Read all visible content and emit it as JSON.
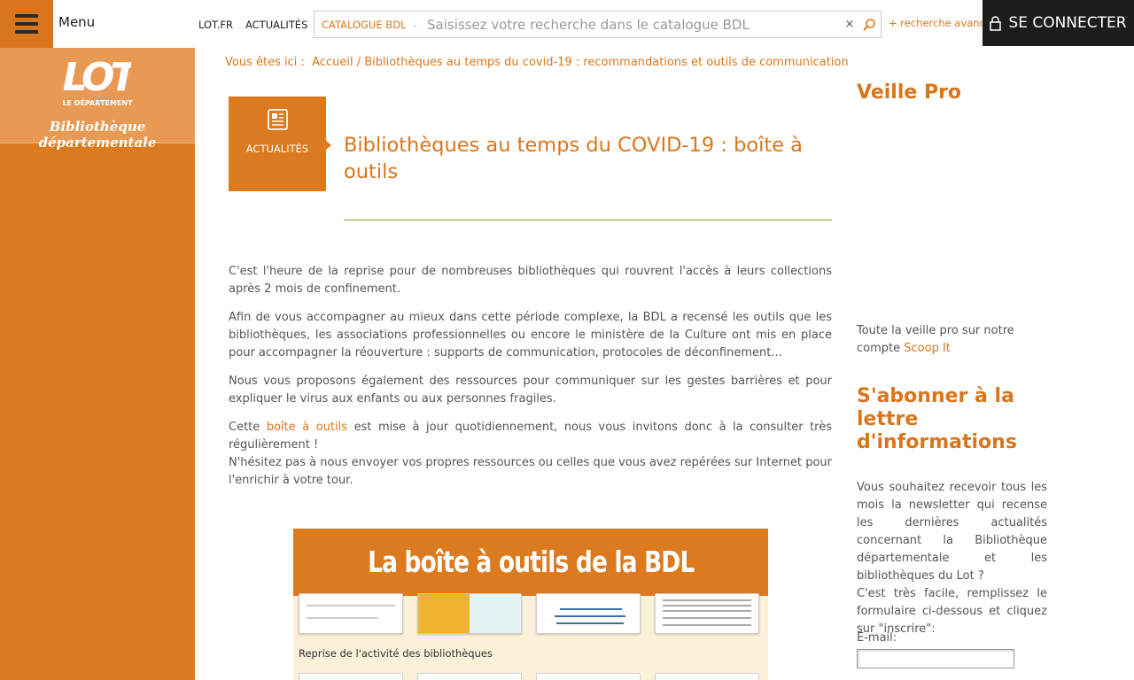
{
  "header": {
    "menu_label": "Menu",
    "links": [
      "LOT.FR",
      "ACTUALITÉS"
    ],
    "search": {
      "category": "CATALOGUE BDL",
      "placeholder": "Saisissez votre recherche dans le catalogue BDL"
    },
    "advanced_search": "+ recherche avancée",
    "connect_label": "SE CONNECTER"
  },
  "sidebar": {
    "logo_text": "LOT",
    "logo_sub": "LE DÉPARTEMENT",
    "logo_title": "Bibliothèque départementale"
  },
  "breadcrumb": {
    "prefix": "Vous êtes ici :",
    "home": "Accueil",
    "separator": "/",
    "current": "Bibliothèques au temps du covid-19 : recommandations et outils de communication"
  },
  "article": {
    "category": "ACTUALITÉS",
    "title": "Bibliothèques au temps du COVID-19 : boîte à outils",
    "p1": "C'est l'heure de la reprise pour de nombreuses bibliothèques qui rouvrent l'accès à leurs collections après 2 mois de confinement.",
    "p2": "Afin de vous accompagner au mieux dans cette période complexe, la BDL a recensé les outils que les bibliothèques, les associations professionnelles ou encore le ministère de la Culture ont mis en place pour accompagner la réouverture : supports de communication, protocoles de déconfinement...",
    "p3": "Nous vous proposons également des ressources pour communiquer sur les gestes barrières et pour expliquer le virus aux enfants ou aux personnes fragiles.",
    "p4_before": "Cette",
    "p4_link": "boîte à outils",
    "p4_after": "est mise à jour quotidiennement, nous vous invitons donc à la consulter très régulièrement !",
    "p5": "N'hésitez pas à nous envoyer vos propres ressources ou celles que vous avez repérées sur Internet pour l'enrichir à votre tour."
  },
  "toolbox": {
    "heading": "La boîte à outils de la BDL",
    "caption": "Reprise de l'activité des bibliothèques"
  },
  "right": {
    "veille_title": "Veille Pro",
    "veille_text": "Toute la veille pro sur notre compte",
    "veille_link": "Scoop It",
    "subscribe_title": "S'abonner à la lettre d'informations",
    "subscribe_text": "Vous souhaitez recevoir tous les mois la newsletter qui recense les dernières actualités concernant la Bibliothèque départementale et les bibliothèques du Lot ?",
    "subscribe_text2": "C'est très facile, remplissez le formulaire ci-dessous et cliquez sur \"inscrire\":",
    "email_label": "E-mail:"
  },
  "colors": {
    "accent": "#db7a1e",
    "dark": "#1c1c1c"
  }
}
